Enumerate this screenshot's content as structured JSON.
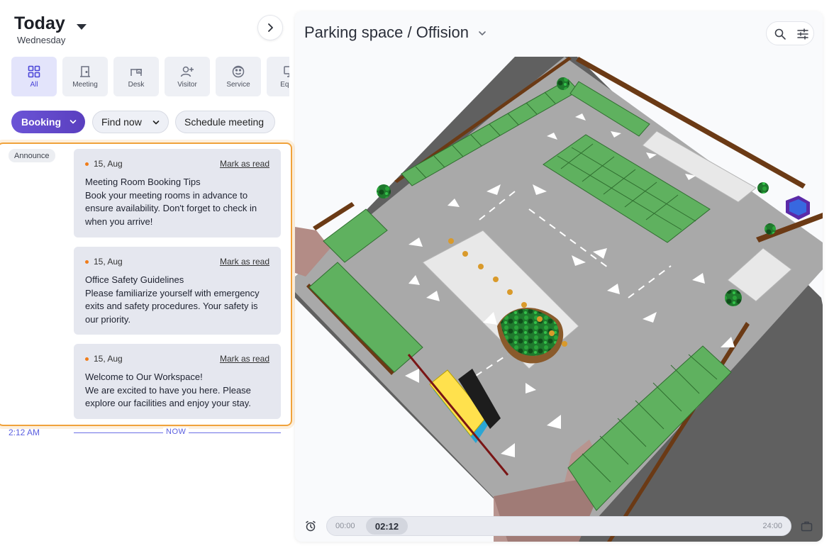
{
  "header": {
    "title": "Today",
    "subtitle": "Wednesday"
  },
  "categories": [
    {
      "label": "All",
      "icon": "grid-icon",
      "active": true
    },
    {
      "label": "Meeting",
      "icon": "door-icon",
      "active": false
    },
    {
      "label": "Desk",
      "icon": "desk-icon",
      "active": false
    },
    {
      "label": "Visitor",
      "icon": "add-user-icon",
      "active": false
    },
    {
      "label": "Service",
      "icon": "smile-face-icon",
      "active": false
    },
    {
      "label": "Equip",
      "icon": "monitor-icon",
      "active": false
    }
  ],
  "actions": {
    "booking": "Booking",
    "find_now": "Find now",
    "schedule_meeting": "Schedule meeting"
  },
  "announce": {
    "tag": "Announce",
    "items": [
      {
        "date": "15, Aug",
        "mark": "Mark as read",
        "title": "Meeting Room Booking Tips",
        "text": "Book your meeting rooms in advance to ensure availability. Don't forget to check in when you arrive!"
      },
      {
        "date": "15, Aug",
        "mark": "Mark as read",
        "title": "Office Safety Guidelines",
        "text": "Please familiarize yourself with emergency exits and safety procedures. Your safety is our priority."
      },
      {
        "date": "15, Aug",
        "mark": "Mark as read",
        "title": "Welcome to Our Workspace!",
        "text": "We are excited to have you here. Please explore our facilities and enjoy your stay."
      }
    ]
  },
  "now": {
    "time": "2:12 AM",
    "label": "NOW"
  },
  "map": {
    "title": "Parking space / Offision",
    "timeline": {
      "start": "00:00",
      "current": "02:12",
      "end": "24:00"
    }
  },
  "colors": {
    "accent": "#5b4fd6",
    "highlight": "#f0a23b",
    "stall": "#5fb15f",
    "asphalt": "#a8a8a8"
  }
}
